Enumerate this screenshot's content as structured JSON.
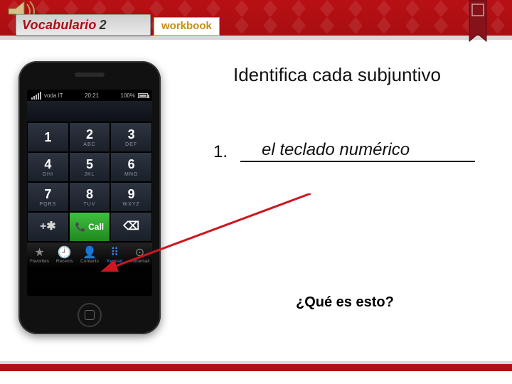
{
  "header": {
    "title_main": "Vocabulario",
    "title_num": "2",
    "workbook_label": "workbook"
  },
  "instruction": "Identifica cada subjuntivo",
  "item": {
    "number": "1.",
    "answer": "el teclado numérico"
  },
  "question": "¿Qué es esto?",
  "phone": {
    "statusbar": {
      "carrier": "voda IT",
      "time": "20:21",
      "battery": "100%"
    },
    "number_field": "",
    "keys": [
      {
        "d": "1",
        "l": ""
      },
      {
        "d": "2",
        "l": "ABC"
      },
      {
        "d": "3",
        "l": "DEF"
      },
      {
        "d": "4",
        "l": "GHI"
      },
      {
        "d": "5",
        "l": "JKL"
      },
      {
        "d": "6",
        "l": "MNO"
      },
      {
        "d": "7",
        "l": "PQRS"
      },
      {
        "d": "8",
        "l": "TUV"
      },
      {
        "d": "9",
        "l": "WXYZ"
      },
      {
        "d": "+✱",
        "l": "",
        "util": true
      },
      {
        "d": "Call",
        "l": "",
        "call": true
      },
      {
        "d": "⌫",
        "l": "",
        "back": true
      }
    ],
    "tabs": [
      {
        "label": "Favorites",
        "glyph": "★"
      },
      {
        "label": "Recents",
        "glyph": "🕘"
      },
      {
        "label": "Contacts",
        "glyph": "👤"
      },
      {
        "label": "Keypad",
        "glyph": "⠿",
        "selected": true
      },
      {
        "label": "Voicemail",
        "glyph": "⊙"
      }
    ]
  }
}
